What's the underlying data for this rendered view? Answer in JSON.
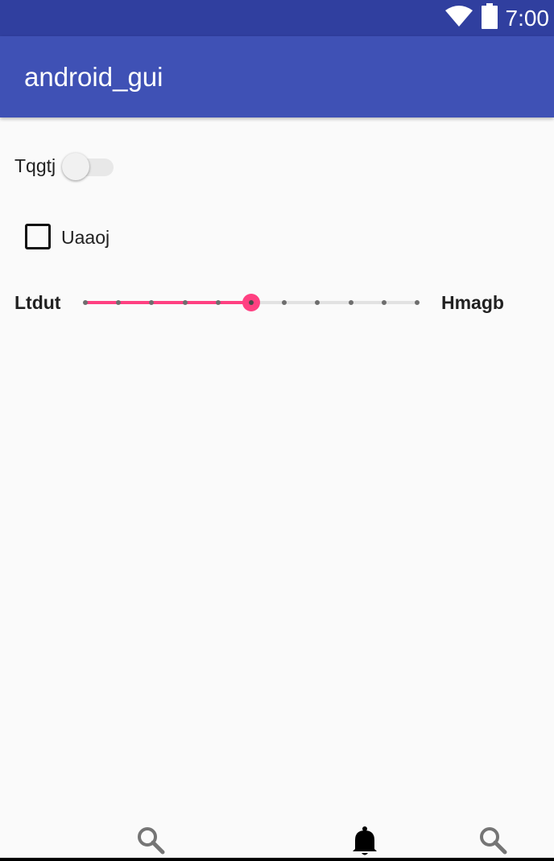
{
  "status_bar": {
    "time": "7:00",
    "icons": [
      "wifi-icon",
      "battery-icon"
    ],
    "background": "#303f9f"
  },
  "app_bar": {
    "title": "android_gui",
    "background": "#3f51b5"
  },
  "switch": {
    "label": "Tqgtj",
    "checked": false
  },
  "checkbox": {
    "label": "Uaaoj",
    "checked": false
  },
  "slider": {
    "left_label": "Ltdut",
    "right_label": "Hmagb",
    "min": 0,
    "max": 10,
    "value": 5,
    "accent": "#ff4081"
  },
  "bottom_nav": {
    "items": [
      {
        "icon": "search-icon",
        "selected": false
      },
      {
        "icon": "bell-icon",
        "selected": true
      },
      {
        "icon": "search-icon",
        "selected": false
      }
    ]
  }
}
